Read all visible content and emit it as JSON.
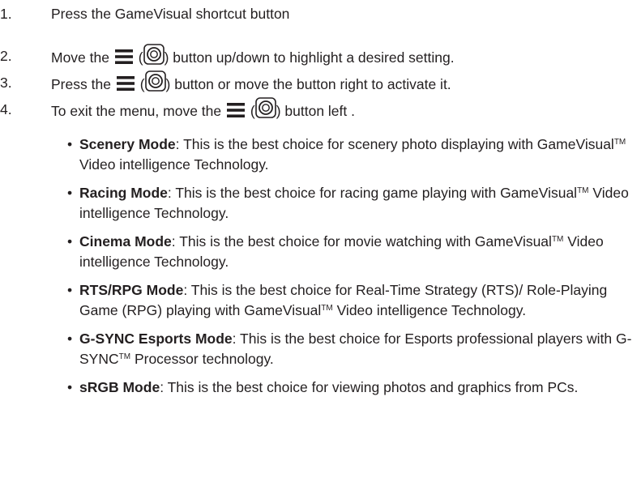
{
  "steps": [
    {
      "num": "1.",
      "text": "Press the GameVisual shortcut button"
    },
    {
      "num": "2.",
      "pre": "Move the",
      "post": "button up/down to highlight a desired setting."
    },
    {
      "num": "3.",
      "pre": "Press the",
      "post": "button or move the button right to activate it."
    },
    {
      "num": "4.",
      "pre": "To exit the menu, move the",
      "post": "button left ."
    }
  ],
  "paren_open": "(",
  "paren_close": ")",
  "bullet_char": "•",
  "tm": "TM",
  "modes": [
    {
      "name": "Scenery Mode",
      "text_a": ": This is the best choice for scenery photo displaying with GameVisual",
      "text_b": " Video intelligence Technology."
    },
    {
      "name": "Racing Mode",
      "text_a": ": This is the best choice for racing game playing with GameVisual",
      "text_b": " Video intelligence Technology."
    },
    {
      "name": "Cinema Mode",
      "text_a": ": This is the best choice for movie watching with GameVisual",
      "text_b": " Video intelligence Technology."
    },
    {
      "name": "RTS/RPG Mode",
      "text_a": ": This is the best choice for Real-Time Strategy (RTS)/ Role-Playing Game (RPG) playing with GameVisual",
      "text_b": " Video intelligence Technology."
    },
    {
      "name": "G-SYNC Esports Mode",
      "text_a": ": This is the best choice for Esports professional players with G-SYNC",
      "text_b": " Processor technology."
    },
    {
      "name": "sRGB Mode",
      "text_a": ": This is the best choice for viewing photos and graphics from PCs."
    }
  ],
  "icons": {
    "menu": "menu-icon",
    "joystick": "joystick-icon"
  }
}
